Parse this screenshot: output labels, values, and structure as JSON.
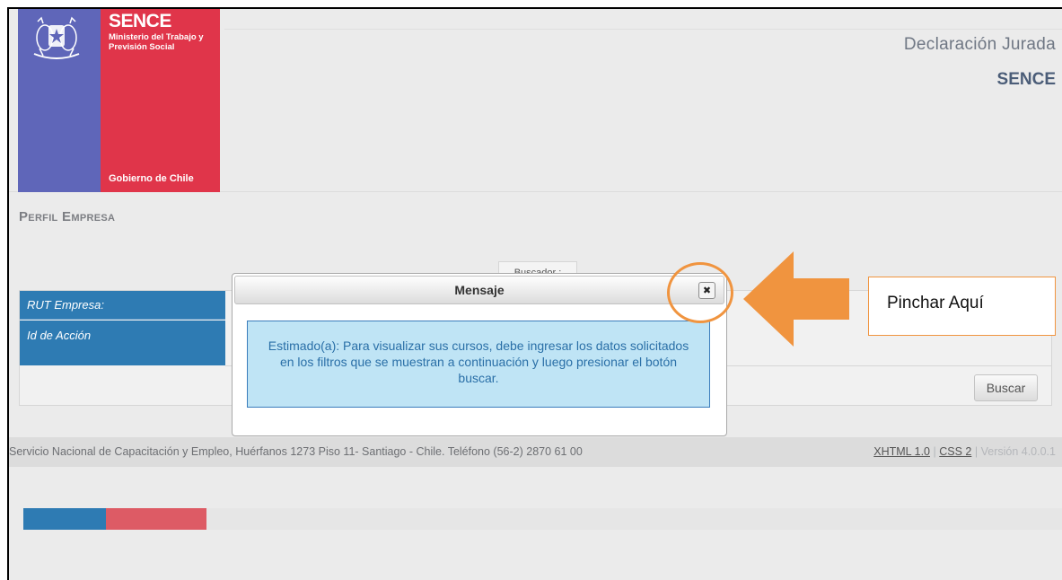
{
  "header": {
    "logo": {
      "name": "SENCE",
      "ministry": "Ministerio del Trabajo y Previsión Social",
      "government": "Gobierno de Chile"
    },
    "title": "Declaración Jurada",
    "subtitle": "SENCE"
  },
  "main": {
    "section_title": "Perfil Empresa",
    "search_tab_label": "Buscador :",
    "fields": [
      {
        "label": "RUT Empresa:"
      },
      {
        "label": "Id de Acción"
      }
    ],
    "search_button": "Buscar"
  },
  "modal": {
    "title": "Mensaje",
    "close_glyph": "✖",
    "message": "Estimado(a): Para visualizar sus cursos, debe ingresar los datos solicitados en los filtros que se muestran a continuación y luego presionar el botón buscar."
  },
  "footer": {
    "info": "Servicio Nacional de Capacitación y Empleo, Huérfanos 1273 Piso 11- Santiago - Chile. Teléfono (56-2) 2870 61 00",
    "xhtml_link": "XHTML 1.0",
    "css_link": "CSS 2",
    "separator": "|",
    "version": "Versión 4.0.0.1"
  },
  "annotation": {
    "callout_text": "Pinchar Aquí",
    "colors": {
      "accent": "#f0943f"
    }
  },
  "colors": {
    "blue": "#2e7bb3",
    "red": "#e0354a",
    "logo_blue": "#5f66b9",
    "message_bg": "#bfe4f5"
  }
}
